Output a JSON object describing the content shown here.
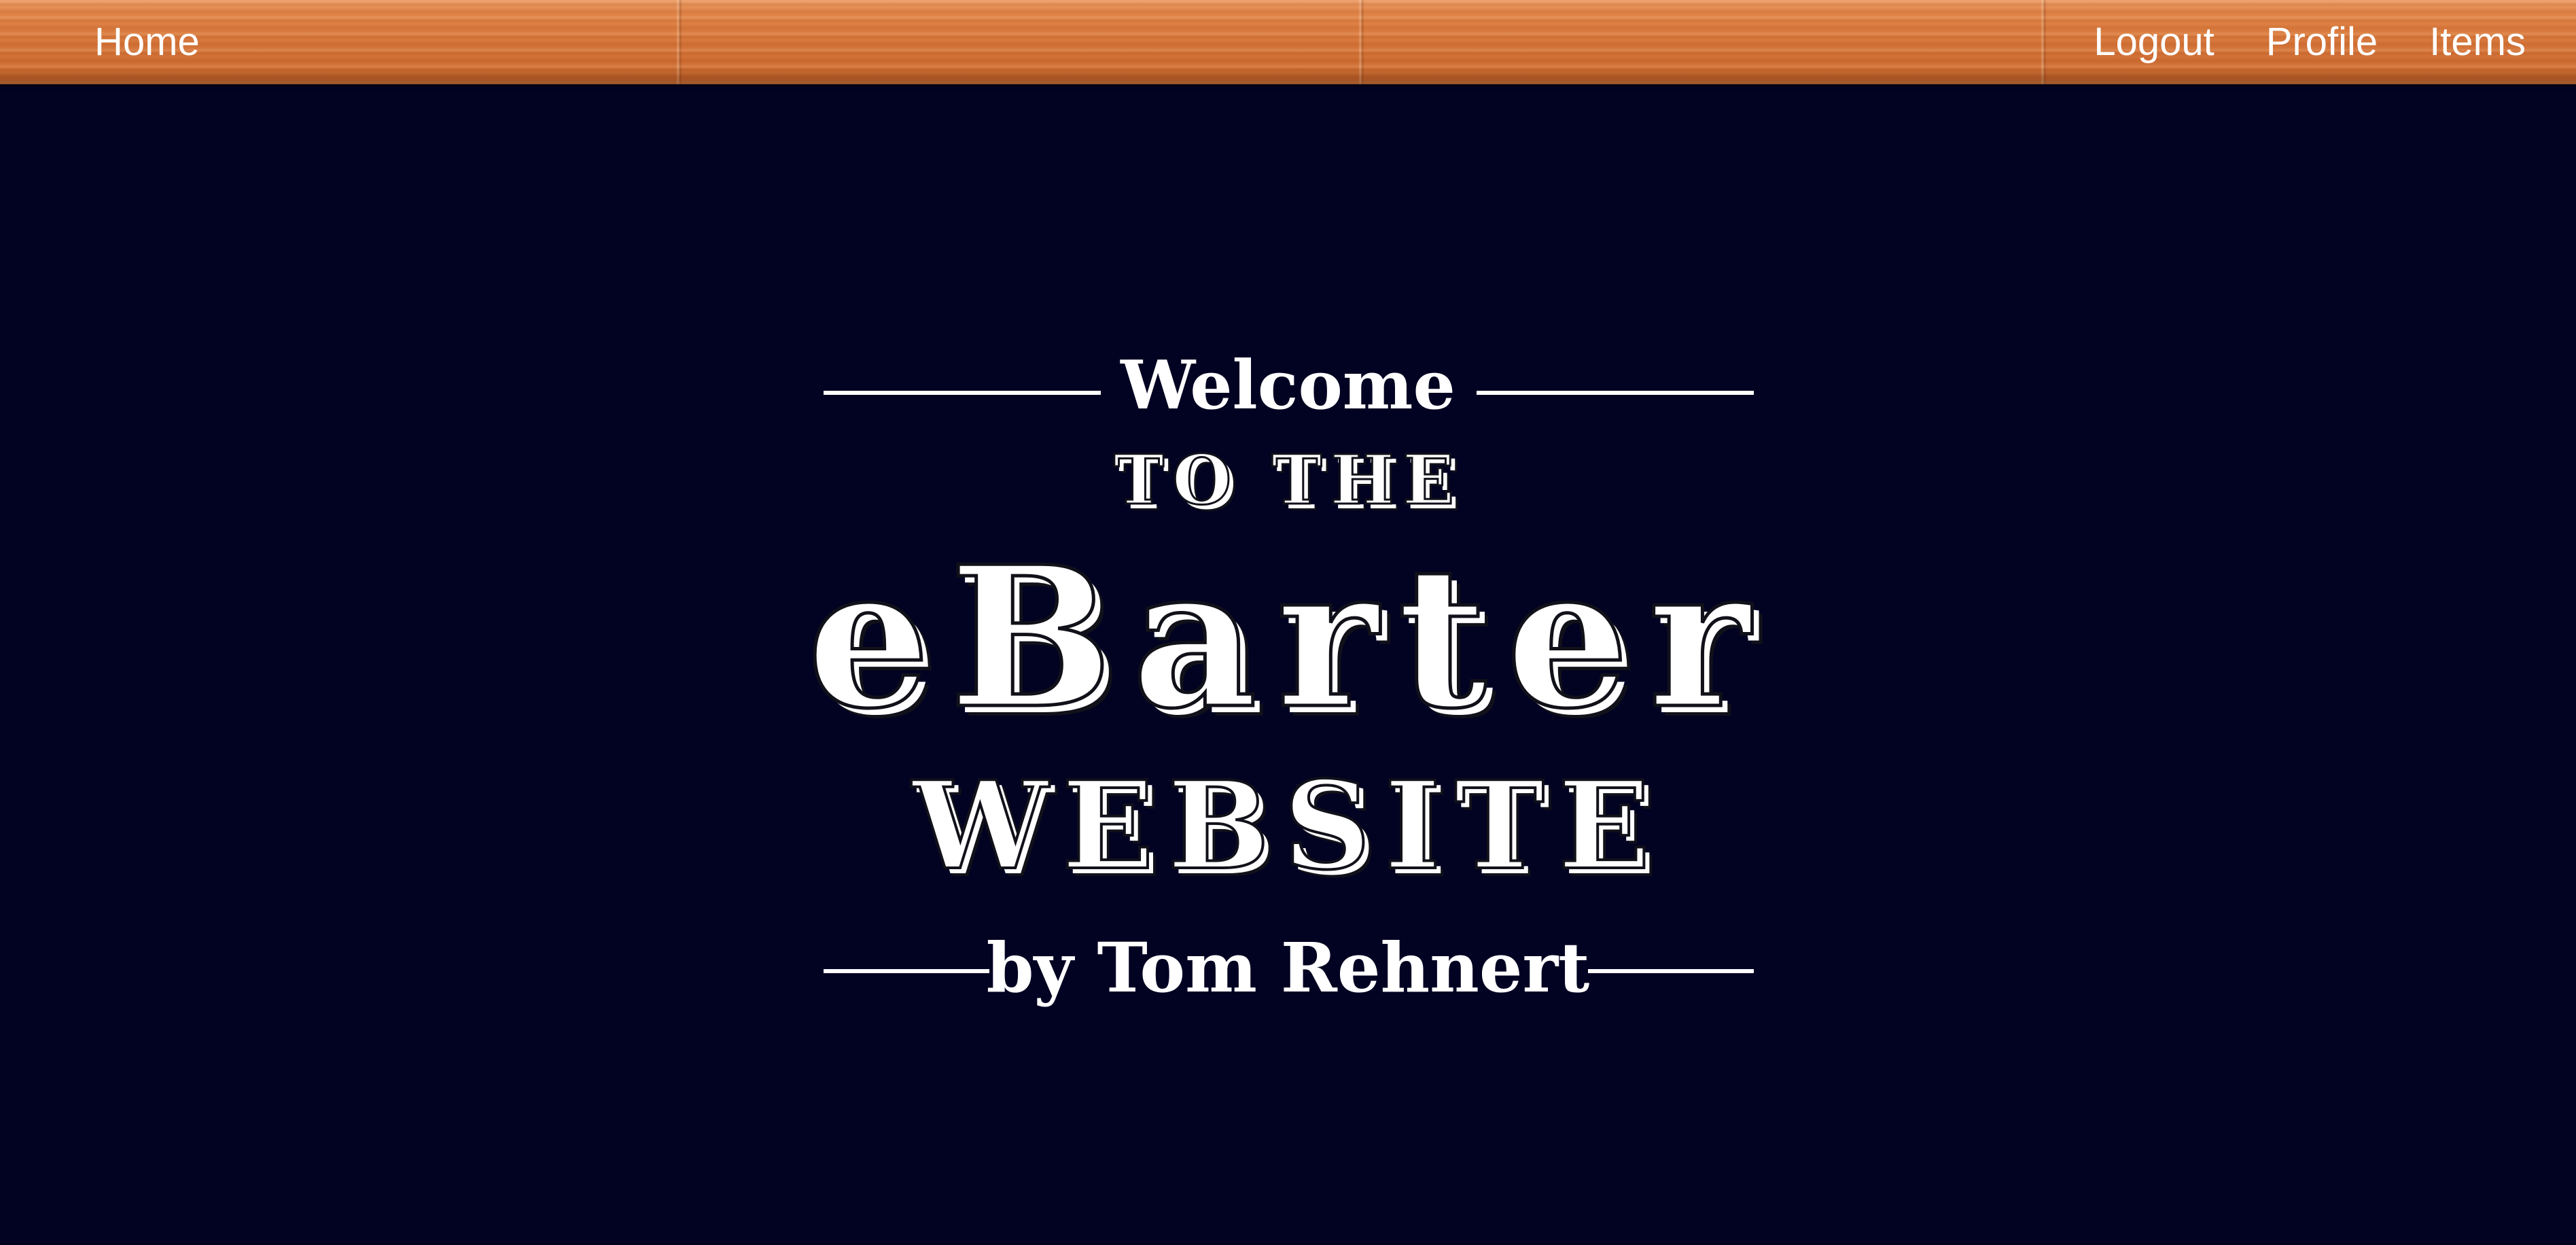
{
  "nav": {
    "home_label": "Home",
    "logout_label": "Logout",
    "profile_label": "Profile",
    "items_label": "Items"
  },
  "hero": {
    "welcome": "Welcome",
    "to_the": "TO THE",
    "brand": "eBarter",
    "website": "WEBSITE",
    "author": "by Tom Rehnert"
  },
  "colors": {
    "background": "#020222",
    "navbar_wood": "#d9793d",
    "text": "#ffffff"
  }
}
